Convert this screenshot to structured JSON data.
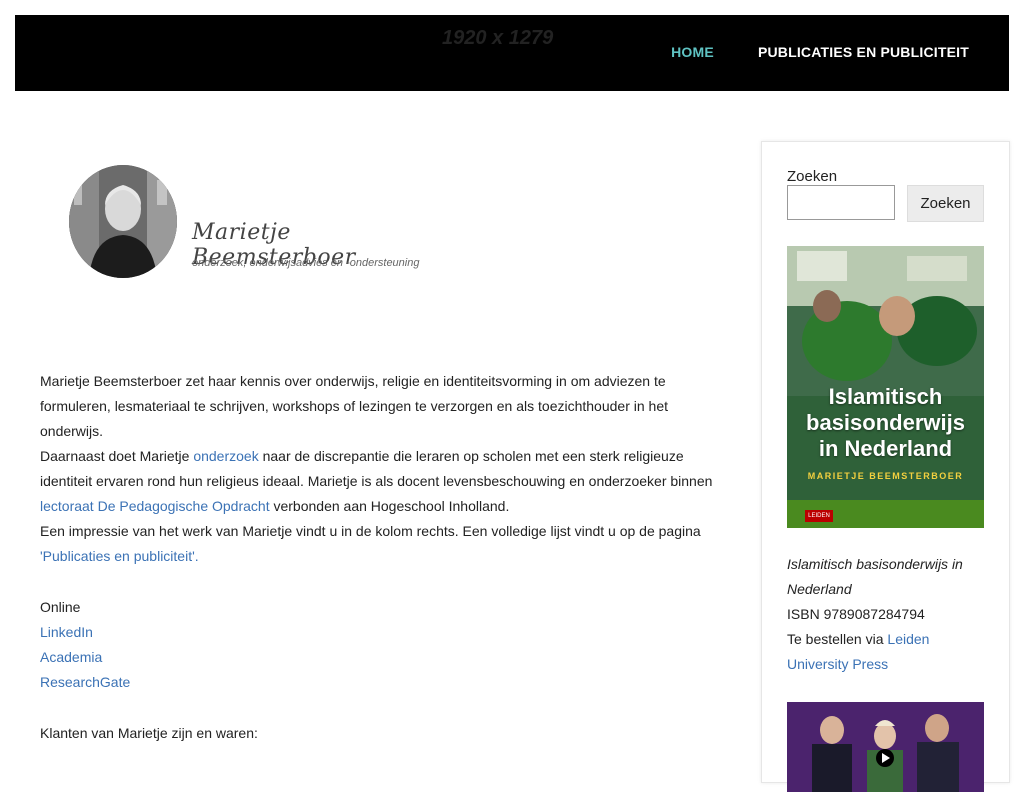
{
  "header": {
    "placeholder_dimensions": "1920 x 1279",
    "nav": {
      "home": "HOME",
      "publications": "PUBLICATIES EN PUBLICITEIT"
    }
  },
  "logo": {
    "name": "Marietje Beemsterboer",
    "tagline": "onderzoek, onderwijsadvies en -ondersteuning"
  },
  "main": {
    "p1": "Marietje Beemsterboer zet haar kennis over onderwijs, religie en identiteitsvorming in om adviezen te formuleren, lesmateriaal te schrijven, workshops of lezingen te verzorgen en als toezichthouder in het onderwijs.",
    "p2_a": "Daarnaast doet Marietje ",
    "p2_link1": "onderzoek",
    "p2_b": " naar de discrepantie die leraren op scholen met een sterk religieuze identiteit ervaren rond hun religieus ideaal. Marietje is als docent levensbeschouwing en onderzoeker binnen ",
    "p2_link2": "lectoraat De Pedagogische Opdracht",
    "p2_c": " verbonden aan Hogeschool Inholland.",
    "p3_a": "Een impressie van het werk van Marietje vindt u in de kolom rechts. Een volledige lijst vindt u op de pagina ",
    "p3_link": "'Publicaties en publiciteit'.",
    "online_heading": "Online",
    "links": [
      "LinkedIn",
      "Academia",
      "ResearchGate"
    ],
    "clients": "Klanten van Marietje zijn en waren:"
  },
  "sidebar": {
    "search_label": "Zoeken",
    "search_value": "",
    "search_button": "Zoeken",
    "book": {
      "cover_title_lines": [
        "Islamitisch",
        "basisonderwijs",
        "in Nederland"
      ],
      "cover_author": "MARIETJE BEEMSTERBOER",
      "cover_publisher": "LEIDEN",
      "title": "Islamitisch basisonderwijs in Nederland",
      "isbn": "ISBN 9789087284794",
      "order_prefix": "Te bestellen via ",
      "order_link": "Leiden University Press"
    }
  },
  "colors": {
    "header_bg": "#000000",
    "nav_active": "#5fc3c3",
    "link": "#3b72b5"
  }
}
